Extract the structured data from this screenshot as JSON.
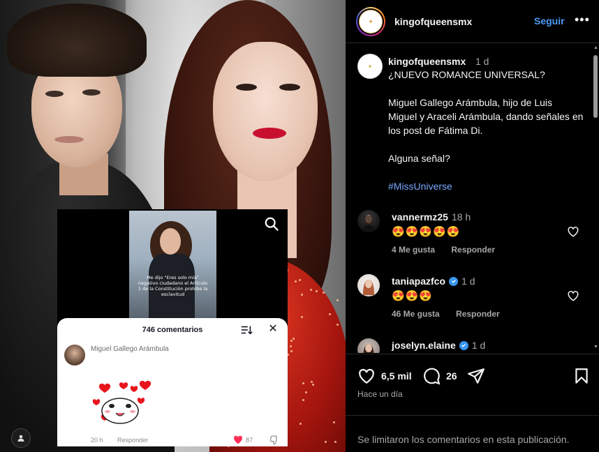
{
  "post_image": {
    "video_caption": "Me dijo \"Eres solo mía\" negativo ciudadano el Artículo 1 de la Constitución prohibe la esclavitud",
    "comments_sheet": {
      "title": "746 comentarios",
      "comment": {
        "user": "Miguel Gallego Arámbula",
        "time": "20 h",
        "reply_label": "Responder",
        "likes": "87"
      }
    }
  },
  "header": {
    "username": "kingofqueensmx",
    "follow_label": "Seguir",
    "more_label": "•••"
  },
  "caption": {
    "username": "kingofqueensmx",
    "time": "1 d",
    "line1": "¿NUEVO ROMANCE UNIVERSAL?",
    "paragraph": "Miguel Gallego Arámbula, hijo de Luis Miguel y Araceli Arámbula, dando señales en los post de Fátima Di.",
    "question": "Alguna señal?",
    "hashtag": "#MissUniverse"
  },
  "comments": [
    {
      "user": "vannermz25",
      "time": "18 h",
      "verified": false,
      "text": "😍😍😍😍😍",
      "likes": "4 Me gusta",
      "reply": "Responder"
    },
    {
      "user": "taniapazfco",
      "time": "1 d",
      "verified": true,
      "text": "😍😍😍",
      "likes": "46 Me gusta",
      "reply": "Responder"
    },
    {
      "user": "joselyn.elaine",
      "time": "1 d",
      "verified": true
    }
  ],
  "actions": {
    "likes": "6,5 mil",
    "comments": "26",
    "posted": "Hace un día"
  },
  "footer": {
    "limited_text": "Se limitaron los comentarios en esta publicación."
  },
  "colors": {
    "background": "#000000",
    "link_blue": "#4a9cf7",
    "hashtag": "#7aa8ff",
    "muted": "#a8a8a8"
  }
}
